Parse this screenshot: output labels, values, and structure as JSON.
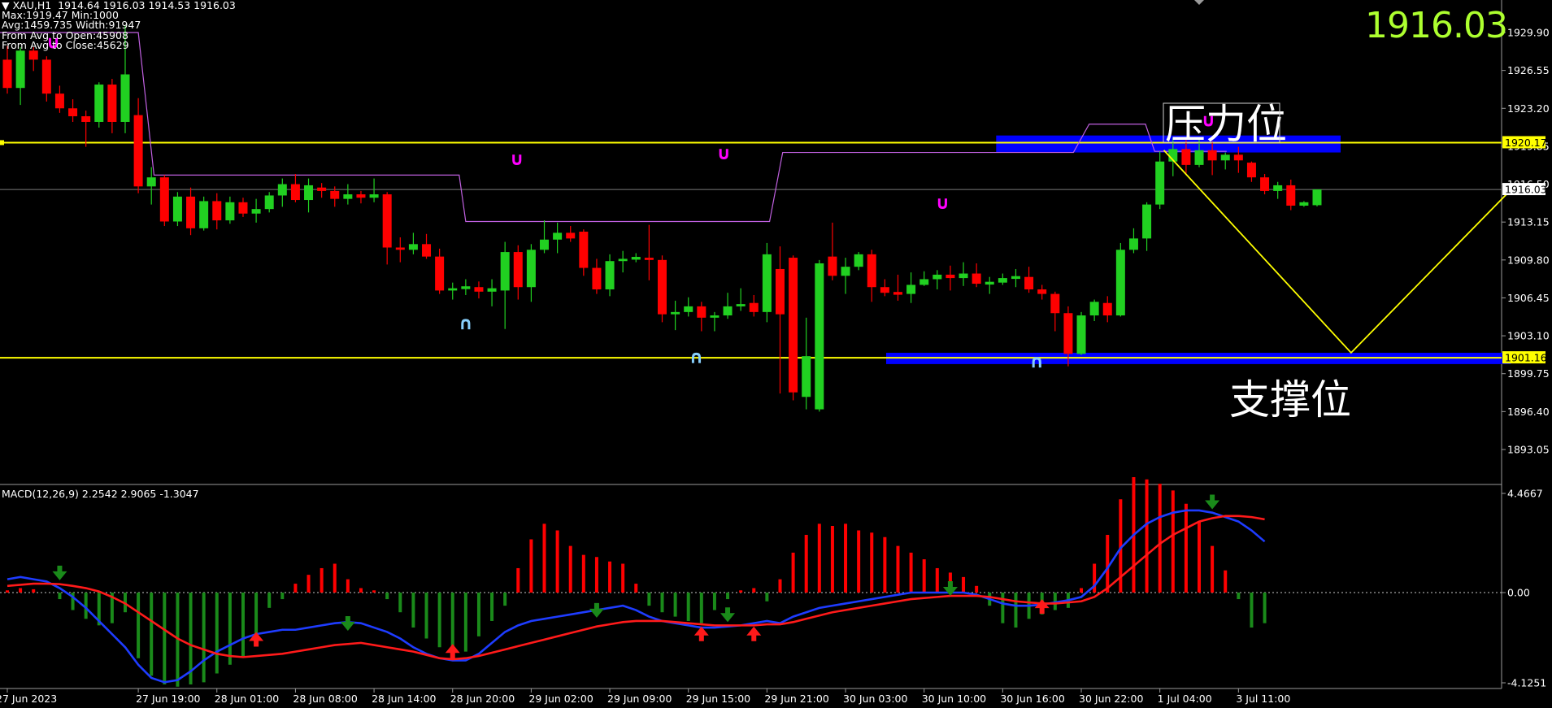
{
  "header": {
    "symbol": "▼ XAU,H1",
    "ohlc": "1914.64 1916.03 1914.53 1916.03",
    "line2": "Max:1919.47 Min:1000",
    "line3": "Avg:1459.735 Width:91947",
    "line4": "From Avg to Open:45908",
    "line5": "From Avg to Close:45629"
  },
  "big_price": "1916.03",
  "annotations": {
    "resistance": "压力位",
    "support": "支撑位"
  },
  "colors": {
    "bull": "#21d021",
    "bear": "#ff0000",
    "hline": "#ffff00",
    "zone": "#0000ff",
    "macd_line": "#1e3cff",
    "signal_line": "#ff1a1a",
    "envelope": "#c060e0",
    "arrow_up": "#ff1a1a",
    "arrow_down": "#1a8a1a",
    "fractal_top": "#ff00ff",
    "fractal_bottom": "#87cefa"
  },
  "chart_data": [
    {
      "type": "candlestick",
      "name": "price",
      "y_ticks": [
        "1929.90",
        "1926.55",
        "1923.20",
        "1919.85",
        "1916.50",
        "1913.15",
        "1909.80",
        "1906.45",
        "1903.10",
        "1899.75",
        "1896.40",
        "1893.05"
      ],
      "ylim": [
        1891.8,
        1931.2
      ],
      "x_ticks": [
        "27 Jun 2023",
        "27 Jun 19:00",
        "28 Jun 01:00",
        "28 Jun 08:00",
        "28 Jun 14:00",
        "28 Jun 20:00",
        "29 Jun 02:00",
        "29 Jun 09:00",
        "29 Jun 15:00",
        "29 Jun 21:00",
        "30 Jun 03:00",
        "30 Jun 10:00",
        "30 Jun 16:00",
        "30 Jun 22:00",
        "1 Jul 04:00",
        "3 Jul 11:00"
      ],
      "x_tick_bar_index": [
        0,
        10,
        16,
        22,
        28,
        34,
        40,
        46,
        52,
        58,
        64,
        70,
        76,
        82,
        88,
        94
      ],
      "price_labels": [
        {
          "value": 1920.17,
          "text": "1920.17",
          "style": "yellow"
        },
        {
          "value": 1916.03,
          "text": "1916.03",
          "style": "white"
        },
        {
          "value": 1901.16,
          "text": "1901.16",
          "style": "yellow"
        }
      ],
      "hlines": [
        1920.17,
        1901.16
      ],
      "current_price_line": 1916.03,
      "zones": [
        {
          "y1": 1919.3,
          "y2": 1920.8,
          "from_bar": 75.5,
          "to_bar": 101.8
        },
        {
          "y1": 1900.6,
          "y2": 1901.6,
          "from_bar": 67.1,
          "to_bar": 114.8
        }
      ],
      "projection": [
        [
          88.3,
          1919.5
        ],
        [
          102.6,
          1901.6
        ],
        [
          114.8,
          1916.0
        ]
      ],
      "envelope": [
        [
          -2,
          1929.9
        ],
        [
          10,
          1929.9
        ],
        [
          11.2,
          1917.3
        ],
        [
          34.5,
          1917.3
        ],
        [
          35,
          1913.2
        ],
        [
          58.2,
          1913.2
        ],
        [
          59.2,
          1919.3
        ],
        [
          81.4,
          1919.3
        ],
        [
          82.6,
          1921.8
        ],
        [
          86.9,
          1921.8
        ],
        [
          87.6,
          1919.4
        ],
        [
          93.1,
          1919.4
        ]
      ],
      "fractals_up": [
        [
          3.5,
          1929.0
        ],
        [
          38.9,
          1918.7
        ],
        [
          54.7,
          1919.2
        ],
        [
          71.4,
          1914.8
        ],
        [
          91.7,
          1922.1
        ]
      ],
      "fractals_down": [
        [
          35,
          1904.2
        ],
        [
          52.6,
          1901.2
        ],
        [
          78.6,
          1900.8
        ]
      ],
      "candles": [
        [
          1927.5,
          1925.0,
          1928.7,
          1924.5
        ],
        [
          1925.0,
          1928.3,
          1928.6,
          1923.5
        ],
        [
          1928.3,
          1927.5,
          1928.6,
          1926.5
        ],
        [
          1927.5,
          1924.5,
          1927.8,
          1923.8
        ],
        [
          1924.5,
          1923.2,
          1925.2,
          1922.8
        ],
        [
          1923.2,
          1922.5,
          1924.0,
          1922.0
        ],
        [
          1922.5,
          1922.0,
          1923.0,
          1919.8
        ],
        [
          1922.0,
          1925.3,
          1925.5,
          1921.5
        ],
        [
          1925.3,
          1922.0,
          1925.8,
          1921.0
        ],
        [
          1922.0,
          1926.2,
          1930.5,
          1921.0
        ],
        [
          1922.6,
          1916.3,
          1924.1,
          1915.7
        ],
        [
          1916.3,
          1917.1,
          1918.0,
          1914.7
        ],
        [
          1917.1,
          1913.2,
          1917.3,
          1912.8
        ],
        [
          1913.2,
          1915.4,
          1915.8,
          1912.8
        ],
        [
          1915.4,
          1912.6,
          1916.2,
          1912.0
        ],
        [
          1912.6,
          1915.0,
          1915.4,
          1912.4
        ],
        [
          1915.0,
          1913.3,
          1915.7,
          1912.5
        ],
        [
          1913.3,
          1914.9,
          1915.4,
          1913.0
        ],
        [
          1914.9,
          1913.9,
          1915.3,
          1913.6
        ],
        [
          1913.9,
          1914.3,
          1915.2,
          1913.1
        ],
        [
          1914.3,
          1915.5,
          1915.8,
          1914.0
        ],
        [
          1915.5,
          1916.5,
          1917.0,
          1914.5
        ],
        [
          1916.5,
          1915.1,
          1917.4,
          1914.9
        ],
        [
          1915.1,
          1916.4,
          1917.0,
          1914.0
        ],
        [
          1916.2,
          1915.9,
          1916.6,
          1915.3
        ],
        [
          1915.9,
          1915.2,
          1916.3,
          1914.5
        ],
        [
          1915.2,
          1915.6,
          1916.5,
          1914.7
        ],
        [
          1915.6,
          1915.3,
          1915.9,
          1914.8
        ],
        [
          1915.3,
          1915.6,
          1917.0,
          1914.9
        ],
        [
          1915.6,
          1910.9,
          1915.8,
          1909.4
        ],
        [
          1910.9,
          1910.7,
          1911.8,
          1909.6
        ],
        [
          1910.7,
          1911.2,
          1912.2,
          1910.3
        ],
        [
          1911.2,
          1910.1,
          1912.1,
          1909.9
        ],
        [
          1910.1,
          1907.1,
          1910.8,
          1906.8
        ],
        [
          1907.1,
          1907.3,
          1907.8,
          1906.3
        ],
        [
          1907.3,
          1907.4,
          1908.1,
          1906.7
        ],
        [
          1907.4,
          1907.0,
          1907.9,
          1906.4
        ],
        [
          1907.0,
          1907.3,
          1908.1,
          1905.7
        ],
        [
          1907.1,
          1910.5,
          1911.4,
          1903.7
        ],
        [
          1910.5,
          1907.4,
          1911.1,
          1906.3
        ],
        [
          1907.4,
          1910.7,
          1911.2,
          1906.1
        ],
        [
          1910.7,
          1911.6,
          1913.3,
          1910.4
        ],
        [
          1911.6,
          1912.2,
          1913.1,
          1910.4
        ],
        [
          1912.2,
          1911.7,
          1912.8,
          1911.4
        ],
        [
          1912.3,
          1909.1,
          1912.5,
          1908.4
        ],
        [
          1909.1,
          1907.2,
          1909.9,
          1906.8
        ],
        [
          1907.2,
          1909.7,
          1910.3,
          1906.6
        ],
        [
          1909.7,
          1909.9,
          1910.6,
          1908.7
        ],
        [
          1909.9,
          1910.0,
          1910.4,
          1909.6
        ],
        [
          1910.0,
          1909.8,
          1912.9,
          1908.0
        ],
        [
          1909.8,
          1905.0,
          1910.2,
          1904.3
        ],
        [
          1905.0,
          1905.2,
          1906.2,
          1903.6
        ],
        [
          1905.2,
          1905.7,
          1906.5,
          1904.8
        ],
        [
          1905.7,
          1904.7,
          1906.1,
          1903.5
        ],
        [
          1904.7,
          1904.9,
          1905.2,
          1903.5
        ],
        [
          1904.9,
          1905.7,
          1906.9,
          1904.6
        ],
        [
          1905.7,
          1905.9,
          1907.3,
          1905.3
        ],
        [
          1906.0,
          1905.2,
          1906.7,
          1904.8
        ],
        [
          1905.2,
          1910.3,
          1911.3,
          1904.3
        ],
        [
          1909.0,
          1905.0,
          1911.0,
          1898.0
        ],
        [
          1910.0,
          1898.1,
          1910.2,
          1897.4
        ],
        [
          1897.7,
          1901.3,
          1904.7,
          1896.6
        ],
        [
          1896.6,
          1909.5,
          1909.8,
          1896.4
        ],
        [
          1910.1,
          1908.4,
          1913.1,
          1908.0
        ],
        [
          1908.4,
          1909.2,
          1910.0,
          1906.8
        ],
        [
          1909.2,
          1910.3,
          1910.5,
          1908.9
        ],
        [
          1910.3,
          1907.4,
          1910.7,
          1906.1
        ],
        [
          1907.4,
          1906.9,
          1908.1,
          1906.6
        ],
        [
          1906.9,
          1906.8,
          1908.5,
          1906.2
        ],
        [
          1906.8,
          1907.6,
          1908.7,
          1906.0
        ],
        [
          1907.6,
          1908.1,
          1908.8,
          1907.5
        ],
        [
          1908.1,
          1908.5,
          1908.9,
          1907.2
        ],
        [
          1908.5,
          1908.2,
          1909.3,
          1907.1
        ],
        [
          1908.2,
          1908.6,
          1909.6,
          1907.5
        ],
        [
          1908.6,
          1907.7,
          1909.5,
          1907.4
        ],
        [
          1907.7,
          1907.8,
          1908.3,
          1906.8
        ],
        [
          1907.8,
          1908.2,
          1908.6,
          1907.6
        ],
        [
          1908.2,
          1908.3,
          1909.0,
          1907.4
        ],
        [
          1908.3,
          1907.2,
          1909.2,
          1906.9
        ],
        [
          1907.2,
          1906.8,
          1907.6,
          1906.3
        ],
        [
          1906.8,
          1905.1,
          1907.0,
          1903.5
        ],
        [
          1905.1,
          1901.5,
          1905.7,
          1900.4
        ],
        [
          1901.5,
          1904.9,
          1905.2,
          1901.4
        ],
        [
          1904.9,
          1906.1,
          1906.3,
          1904.4
        ],
        [
          1906.0,
          1904.9,
          1906.6,
          1904.3
        ],
        [
          1904.9,
          1910.7,
          1911.3,
          1904.8
        ],
        [
          1910.7,
          1911.7,
          1912.6,
          1910.4
        ],
        [
          1911.7,
          1914.7,
          1914.9,
          1910.6
        ],
        [
          1914.7,
          1918.5,
          1919.4,
          1914.3
        ],
        [
          1918.5,
          1919.6,
          1920.6,
          1917.2
        ],
        [
          1919.6,
          1918.2,
          1920.4,
          1917.3
        ],
        [
          1918.2,
          1919.5,
          1920.5,
          1918.0
        ],
        [
          1919.5,
          1918.6,
          1920.3,
          1917.3
        ],
        [
          1918.6,
          1919.1,
          1919.3,
          1917.8
        ],
        [
          1919.1,
          1918.6,
          1919.8,
          1917.5
        ],
        [
          1918.4,
          1917.1,
          1918.5,
          1916.7
        ],
        [
          1917.1,
          1915.9,
          1917.4,
          1915.6
        ],
        [
          1915.9,
          1916.4,
          1916.7,
          1915.2
        ],
        [
          1916.4,
          1914.6,
          1916.9,
          1914.2
        ],
        [
          1914.6,
          1914.9,
          1915.0,
          1914.5
        ],
        [
          1914.64,
          1916.03,
          1916.03,
          1914.53
        ]
      ]
    },
    {
      "type": "macd",
      "name": "MACD(12,26,9)",
      "label": "MACD(12,26,9) 2.2542 2.9065 -1.3047",
      "y_ticks": [
        "4.4667",
        "0.00",
        "-4.1251"
      ],
      "ylim": [
        -4.1251,
        4.4667
      ],
      "histogram": [
        0.1,
        0.2,
        0.15,
        0,
        -0.3,
        -0.8,
        -1.2,
        -1.5,
        -1.4,
        -0.9,
        -3.0,
        -3.8,
        -4.2,
        -4.3,
        -4.2,
        -4.1,
        -3.7,
        -3.3,
        -2.9,
        -2.1,
        -0.7,
        -0.3,
        0.4,
        0.8,
        1.1,
        1.3,
        0.6,
        0.2,
        0.1,
        -0.3,
        -0.9,
        -1.6,
        -2.1,
        -2.5,
        -2.8,
        -2.7,
        -2.0,
        -1.3,
        -0.6,
        1.1,
        2.4,
        3.1,
        2.8,
        2.1,
        1.7,
        1.6,
        1.4,
        1.3,
        0.4,
        -0.6,
        -0.9,
        -1.1,
        -1.3,
        -1.4,
        -0.8,
        -0.3,
        0.1,
        0.2,
        -0.4,
        0.6,
        1.8,
        2.6,
        3.1,
        3.0,
        3.1,
        2.8,
        2.7,
        2.5,
        2.1,
        1.8,
        1.5,
        1.1,
        0.9,
        0.7,
        0.3,
        -0.6,
        -1.4,
        -1.6,
        -1.2,
        -1.0,
        -0.8,
        -0.7,
        0.2,
        1.3,
        2.6,
        4.2,
        5.2,
        5.1,
        4.9,
        4.6,
        4.0,
        3.2,
        2.1,
        1.0,
        -0.3,
        -1.6,
        -1.4
      ],
      "macd": [
        0.6,
        0.7,
        0.6,
        0.5,
        0.2,
        -0.2,
        -0.7,
        -1.3,
        -1.9,
        -2.5,
        -3.3,
        -3.9,
        -4.1,
        -4.0,
        -3.6,
        -3.1,
        -2.7,
        -2.4,
        -2.1,
        -1.9,
        -1.8,
        -1.7,
        -1.7,
        -1.6,
        -1.5,
        -1.4,
        -1.35,
        -1.4,
        -1.6,
        -1.8,
        -2.1,
        -2.5,
        -2.8,
        -3.0,
        -3.1,
        -3.1,
        -2.8,
        -2.3,
        -1.8,
        -1.5,
        -1.3,
        -1.2,
        -1.1,
        -1.0,
        -0.9,
        -0.8,
        -0.7,
        -0.6,
        -0.8,
        -1.1,
        -1.3,
        -1.4,
        -1.5,
        -1.6,
        -1.6,
        -1.55,
        -1.5,
        -1.4,
        -1.3,
        -1.4,
        -1.1,
        -0.9,
        -0.7,
        -0.6,
        -0.5,
        -0.4,
        -0.3,
        -0.2,
        -0.1,
        0.0,
        0.0,
        0.0,
        0.0,
        0.0,
        -0.1,
        -0.3,
        -0.5,
        -0.6,
        -0.6,
        -0.55,
        -0.45,
        -0.35,
        -0.2,
        0.3,
        1.1,
        2.0,
        2.6,
        3.1,
        3.4,
        3.6,
        3.7,
        3.7,
        3.6,
        3.4,
        3.2,
        2.8,
        2.3
      ],
      "signal": [
        0.3,
        0.35,
        0.4,
        0.4,
        0.38,
        0.3,
        0.2,
        0.05,
        -0.2,
        -0.5,
        -0.9,
        -1.3,
        -1.7,
        -2.1,
        -2.4,
        -2.6,
        -2.8,
        -2.9,
        -2.95,
        -2.9,
        -2.85,
        -2.8,
        -2.7,
        -2.6,
        -2.5,
        -2.4,
        -2.35,
        -2.3,
        -2.4,
        -2.5,
        -2.6,
        -2.7,
        -2.85,
        -3.0,
        -3.05,
        -3.0,
        -2.9,
        -2.75,
        -2.6,
        -2.45,
        -2.3,
        -2.15,
        -2.0,
        -1.85,
        -1.7,
        -1.55,
        -1.45,
        -1.35,
        -1.3,
        -1.3,
        -1.3,
        -1.35,
        -1.4,
        -1.45,
        -1.5,
        -1.5,
        -1.5,
        -1.5,
        -1.45,
        -1.45,
        -1.35,
        -1.2,
        -1.05,
        -0.9,
        -0.8,
        -0.7,
        -0.6,
        -0.5,
        -0.4,
        -0.3,
        -0.25,
        -0.2,
        -0.15,
        -0.15,
        -0.15,
        -0.2,
        -0.3,
        -0.4,
        -0.45,
        -0.5,
        -0.5,
        -0.45,
        -0.4,
        -0.2,
        0.2,
        0.7,
        1.2,
        1.7,
        2.2,
        2.6,
        2.9,
        3.2,
        3.35,
        3.45,
        3.45,
        3.4,
        3.3
      ],
      "arrows_up": [
        [
          19,
          -1.95
        ],
        [
          34,
          -2.5
        ],
        [
          53,
          -1.7
        ],
        [
          57,
          -1.7
        ],
        [
          79,
          -0.45
        ]
      ],
      "arrows_down": [
        [
          4,
          0.7
        ],
        [
          26,
          -1.6
        ],
        [
          45,
          -1.0
        ],
        [
          55,
          -1.2
        ],
        [
          72,
          0.0
        ],
        [
          92,
          3.9
        ]
      ]
    }
  ]
}
